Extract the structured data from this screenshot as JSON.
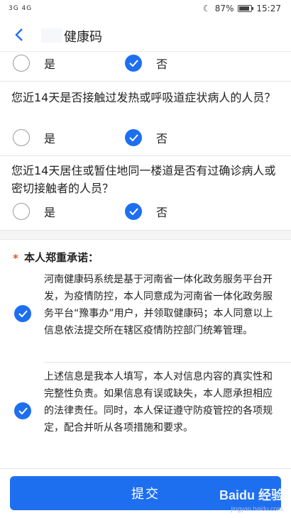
{
  "status_bar": {
    "signal": "3G 4G",
    "battery": "87%",
    "time": "15:27"
  },
  "header": {
    "title": "健康码"
  },
  "questions": [
    {
      "text": "",
      "options": [
        {
          "label": "是",
          "checked": false
        },
        {
          "label": "否",
          "checked": true
        }
      ]
    },
    {
      "text": "您近14天是否接触过发热或呼吸道症状病人的人员？",
      "options": [
        {
          "label": "是",
          "checked": false
        },
        {
          "label": "否",
          "checked": true
        }
      ]
    },
    {
      "text": "您近14天居住或暂住地同一楼道是否有过确诊病人或密切接触者的人员？",
      "options": [
        {
          "label": "是",
          "checked": false
        },
        {
          "label": "否",
          "checked": true
        }
      ]
    }
  ],
  "pledge": {
    "required_mark": "*",
    "title": "本人郑重承诺：",
    "items": [
      {
        "text": "河南健康码系统是基于河南省一体化政务服务平台开发，为疫情防控，本人同意成为河南省一体化政务服务平台“豫事办”用户，并领取健康码；本人同意以上信息依法提交所在辖区疫情防控部门统筹管理。",
        "checked": true
      },
      {
        "text": "上述信息是我本人填写，本人对信息内容的真实性和完整性负责。如果信息有误或缺失，本人愿承担相应的法律责任。同时，本人保证遵守防疫管控的各项规定，配合并听从各项措施和要求。",
        "checked": true
      }
    ]
  },
  "footer": {
    "submit_label": "提交"
  },
  "watermark": {
    "brand": "Baidu 经验",
    "url": "jingyan.baidu.com"
  },
  "colors": {
    "accent": "#1e6ff0",
    "required": "#e8531f"
  }
}
